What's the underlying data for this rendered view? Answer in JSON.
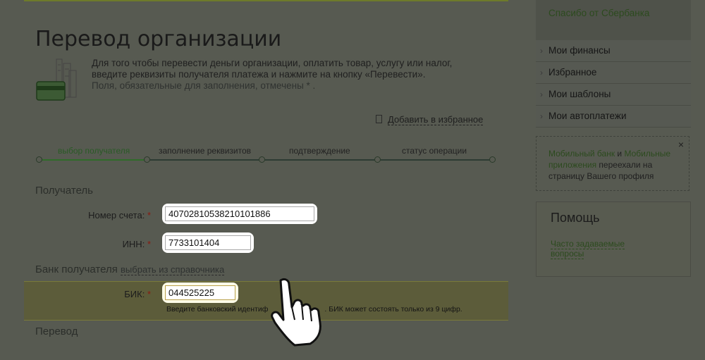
{
  "page": {
    "title": "Перевод организации",
    "intro_line1": "Для того чтобы перевести деньги организации, оплатить товар, услугу или налог,",
    "intro_line2": "введите реквизиты получателя платежа и нажмите на кнопку «Перевести».",
    "intro_line3": "Поля, обязательные для заполнения, отмечены * .",
    "add_favorite": "Добавить в избранное"
  },
  "steps": [
    {
      "label": "выбор получателя",
      "active": true
    },
    {
      "label": "заполнение реквизитов",
      "active": false
    },
    {
      "label": "подтверждение",
      "active": false
    },
    {
      "label": "статус операции",
      "active": false
    }
  ],
  "recipient": {
    "section_title": "Получатель",
    "account_label": "Номер счета:",
    "account_value": "40702810538210101886",
    "inn_label": "ИНН:",
    "inn_value": "7733101404"
  },
  "bank": {
    "section_title": "Банк получателя",
    "directory_link": "выбрать из справочника",
    "bik_label": "БИК:",
    "bik_value": "044525225",
    "bik_hint_left": "Введите банковский идентиф",
    "bik_hint_right": ". БИК может состоять только из 9 цифр."
  },
  "transfer": {
    "section_title": "Перевод"
  },
  "sidebar": {
    "top_link": "Спасибо от Сбербанка",
    "menu": [
      "Мои финансы",
      "Избранное",
      "Мои шаблоны",
      "Мои автоплатежи"
    ],
    "notice_link1": "Мобильный банк",
    "notice_and": " и ",
    "notice_link2": "Мобильные приложения",
    "notice_text": " переехали на страницу Вашего профиля",
    "notice_close": "×",
    "help_title": "Помощь",
    "help_link": "Часто задаваемые вопросы"
  },
  "required_mark": "*",
  "colors": {
    "step_active": "#2f6b2a",
    "step_inactive": "#2d3b33",
    "link_green": "#2c4a1e"
  }
}
